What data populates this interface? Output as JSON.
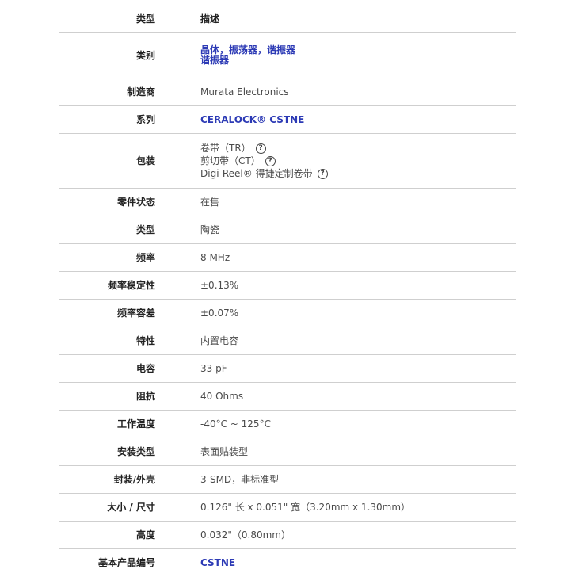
{
  "header": {
    "label": "类型",
    "value": "描述"
  },
  "rows": [
    {
      "label": "类别",
      "value_lines": [
        "晶体，振荡器，谐振器",
        "谐振器"
      ]
    },
    {
      "label": "制造商",
      "value": "Murata Electronics"
    },
    {
      "label": "系列",
      "value": "CERALOCK® CSTNE"
    },
    {
      "label": "包装",
      "value_lines": [
        "卷带（TR）",
        "剪切带（CT）",
        "Digi-Reel® 得捷定制卷带"
      ]
    },
    {
      "label": "零件状态",
      "value": "在售"
    },
    {
      "label": "类型",
      "value": "陶瓷"
    },
    {
      "label": "频率",
      "value": "8 MHz"
    },
    {
      "label": "频率稳定性",
      "value": "±0.13%"
    },
    {
      "label": "频率容差",
      "value": "±0.07%"
    },
    {
      "label": "特性",
      "value": "内置电容"
    },
    {
      "label": "电容",
      "value": "33 pF"
    },
    {
      "label": "阻抗",
      "value": "40 Ohms"
    },
    {
      "label": "工作温度",
      "value": "-40°C ~ 125°C"
    },
    {
      "label": "安装类型",
      "value": "表面贴装型"
    },
    {
      "label": "封装/外壳",
      "value": "3-SMD，非标准型"
    },
    {
      "label": "大小 / 尺寸",
      "value": "0.126\" 长 x 0.051\" 宽（3.20mm x 1.30mm）"
    },
    {
      "label": "高度",
      "value": "0.032\"（0.80mm）"
    },
    {
      "label": "基本产品编号",
      "value": "CSTNE"
    }
  ],
  "colors": {
    "link": "#2c3ab5",
    "divider": "#cfcfcf"
  },
  "icons": {
    "help": "question-circle-icon"
  }
}
